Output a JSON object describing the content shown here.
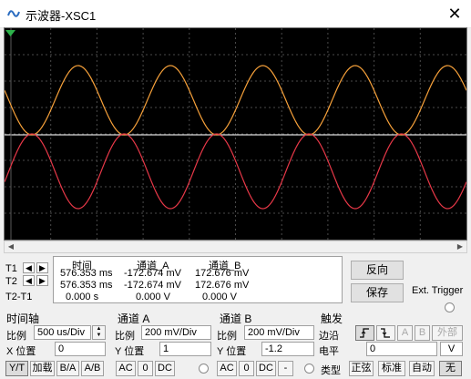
{
  "window": {
    "title": "示波器-XSC1",
    "close_glyph": "✕"
  },
  "cursors": {
    "t1_label": "T1",
    "t2_label": "T2",
    "t2t1_label": "T2-T1"
  },
  "readout": {
    "headers": [
      "时间",
      "通道_A",
      "通道_B"
    ],
    "rows": [
      [
        "576.353 ms",
        "-172.674 mV",
        "172.676 mV"
      ],
      [
        "576.353 ms",
        "-172.674 mV",
        "172.676 mV"
      ],
      [
        "0.000 s",
        "0.000 V",
        "0.000 V"
      ]
    ]
  },
  "buttons": {
    "reverse": "反向",
    "save": "保存",
    "ext_trigger": "Ext. Trigger"
  },
  "timebase": {
    "title": "时间轴",
    "scale_label": "比例",
    "scale_value": "500 us/Div",
    "pos_label": "X 位置",
    "pos_value": "0",
    "modes": [
      "Y/T",
      "加载",
      "B/A",
      "A/B"
    ]
  },
  "channel_a": {
    "title": "通道 A",
    "scale_label": "比例",
    "scale_value": "200 mV/Div",
    "pos_label": "Y 位置",
    "pos_value": "1",
    "coupling": [
      "AC",
      "0",
      "DC"
    ]
  },
  "channel_b": {
    "title": "通道 B",
    "scale_label": "比例",
    "scale_value": "200 mV/Div",
    "pos_label": "Y 位置",
    "pos_value": "-1.2",
    "coupling": [
      "AC",
      "0",
      "DC",
      "-"
    ]
  },
  "trigger": {
    "title": "触发",
    "edge_label": "边沿",
    "level_label": "电平",
    "level_value": "0",
    "level_unit": "V",
    "sources": [
      "A",
      "B",
      "外部"
    ],
    "type_label": "类型",
    "types": [
      "正弦",
      "标准",
      "自动",
      "无"
    ]
  },
  "colors": {
    "channel_a": "#f7a13a",
    "channel_b": "#e83848",
    "grid": "#4a4a4a",
    "screen": "#000000"
  },
  "icons": [
    "oscilloscope-icon",
    "close-icon",
    "arrow-left-icon",
    "arrow-right-icon",
    "rising-edge-icon",
    "falling-edge-icon"
  ]
}
